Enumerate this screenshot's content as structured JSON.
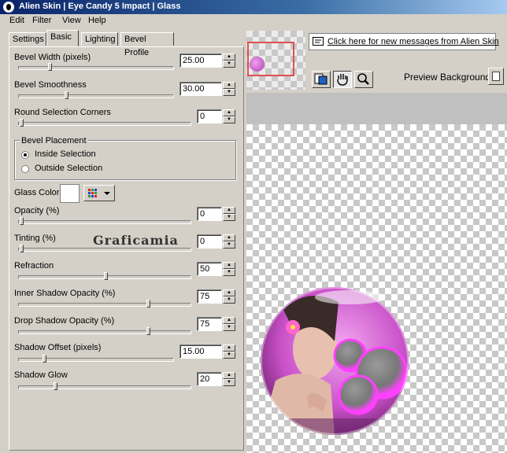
{
  "window": {
    "title": "Alien Skin | Eye Candy 5 Impact | Glass"
  },
  "menu": [
    "Edit",
    "Filter",
    "View",
    "Help"
  ],
  "tabs": [
    "Settings",
    "Basic",
    "Lighting",
    "Bevel Profile"
  ],
  "active_tab": "Basic",
  "controls": {
    "bevel_width": {
      "label": "Bevel Width (pixels)",
      "value": "25.00",
      "level": 0.25
    },
    "bevel_smoothness": {
      "label": "Bevel Smoothness",
      "value": "30.00",
      "level": 0.3
    },
    "round_corners": {
      "label": "Round Selection Corners",
      "value": "0",
      "level": 0
    },
    "opacity": {
      "label": "Opacity (%)",
      "value": "0",
      "level": 0
    },
    "tinting": {
      "label": "Tinting (%)",
      "value": "0",
      "level": 0
    },
    "refraction": {
      "label": "Refraction",
      "value": "50",
      "level": 0.5
    },
    "inner_shadow": {
      "label": "Inner Shadow Opacity (%)",
      "value": "75",
      "level": 0.75
    },
    "drop_shadow": {
      "label": "Drop Shadow Opacity (%)",
      "value": "75",
      "level": 0.75
    },
    "shadow_offset": {
      "label": "Shadow Offset (pixels)",
      "value": "15.00",
      "level": 0.15
    },
    "shadow_glow": {
      "label": "Shadow Glow",
      "value": "20",
      "level": 0.2
    }
  },
  "bevel_placement": {
    "title": "Bevel Placement",
    "options": [
      "Inside Selection",
      "Outside Selection"
    ],
    "selected": "Inside Selection"
  },
  "glass_color": {
    "label": "Glass Color",
    "color": "#ffffff"
  },
  "watermark": "Graficamia",
  "message_link": "Click here for new messages from Alien Skin",
  "preview_background_label": "Preview Background:",
  "colors": {
    "title_start": "#0a246a",
    "title_end": "#a6caf0",
    "nav_box": "#e05050",
    "glass": "#e040e0"
  }
}
